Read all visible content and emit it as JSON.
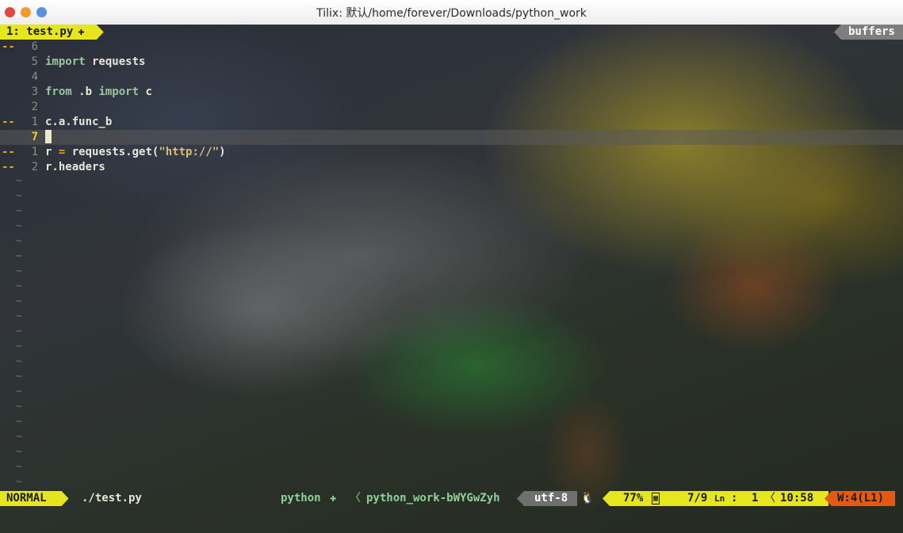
{
  "window": {
    "title": "Tilix: 默认/home/forever/Downloads/python_work"
  },
  "tabline": {
    "active_tab": "1: test.py",
    "active_tab_icon": "python-icon",
    "right_label": "buffers"
  },
  "editor": {
    "lines": [
      {
        "sign": "--",
        "num": "6",
        "text": ""
      },
      {
        "sign": "",
        "num": "5",
        "text": "import requests"
      },
      {
        "sign": "",
        "num": "4",
        "text": ""
      },
      {
        "sign": "",
        "num": "3",
        "text": "from .b import c"
      },
      {
        "sign": "",
        "num": "2",
        "text": ""
      },
      {
        "sign": "--",
        "num": "1",
        "text": "c.a.func_b"
      },
      {
        "sign": "",
        "num": "7",
        "text": ""
      },
      {
        "sign": "--",
        "num": "1",
        "text": "r = requests.get(\"http://\")"
      },
      {
        "sign": "--",
        "num": "2",
        "text": "r.headers"
      }
    ],
    "empty_marker": "~"
  },
  "statusline": {
    "mode": "NORMAL",
    "filename": "./test.py",
    "filetype": "python",
    "venv": "python_work-bWYGwZyh",
    "encoding": "utf-8",
    "percent": "77%",
    "line": "7/9",
    "col_sep": ":",
    "column": "1",
    "time": "10:58",
    "warning": "W:4(L1)"
  },
  "colors": {
    "accent_yellow": "#e6e61e",
    "warning_orange": "#e55a10",
    "sign_orange": "#e6a21e",
    "keyword_green": "#9ac5a0"
  }
}
